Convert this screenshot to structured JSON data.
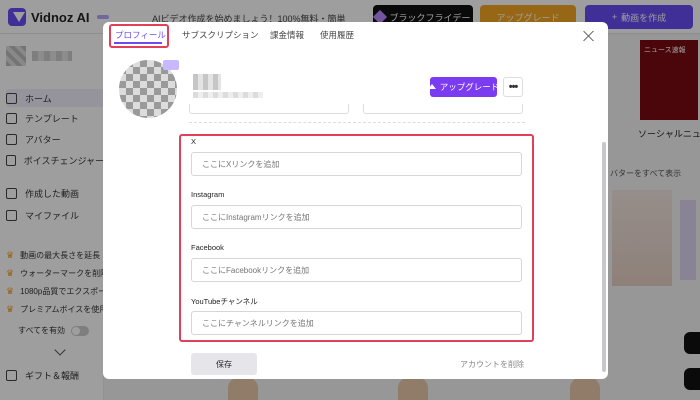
{
  "app": {
    "logo_text": "Vidnoz AI",
    "logo_badge": "",
    "promo_text": "AIビデオ作成を始めましょう！100%無料・簡単",
    "black_friday_label": "ブラックフライデー",
    "upgrade_label": "アップグレード",
    "create_video_label": "動画を作成"
  },
  "sidebar": {
    "items": [
      {
        "label": "ホーム"
      },
      {
        "label": "テンプレート"
      },
      {
        "label": "アバター"
      },
      {
        "label": "ボイスチェンジャー"
      },
      {
        "label": "作成した動画"
      },
      {
        "label": "マイファイル"
      }
    ],
    "premium": [
      {
        "label": "動画の最大長さを延長"
      },
      {
        "label": "ウォーターマークを削除"
      },
      {
        "label": "1080p品質でエクスポート"
      },
      {
        "label": "プレミアムボイスを使用"
      }
    ],
    "enable_all_label": "すべてを有効",
    "gift_label": "ギフト＆報酬"
  },
  "right_panel": {
    "card_text": "ニュース速報",
    "label": "ソーシャルニュ",
    "link": "バターをすべて表示"
  },
  "modal": {
    "tabs": [
      {
        "label": "プロフィール"
      },
      {
        "label": "サブスクリプション"
      },
      {
        "label": "課金情報"
      },
      {
        "label": "使用履歴"
      }
    ],
    "upgrade_label": "アップグレード",
    "more_label": "•••",
    "fields": [
      {
        "label": "X",
        "placeholder": "ここにXリンクを追加"
      },
      {
        "label": "Instagram",
        "placeholder": "ここにInstagramリンクを追加"
      },
      {
        "label": "Facebook",
        "placeholder": "ここにFacebookリンクを追加"
      },
      {
        "label": "YouTubeチャンネル",
        "placeholder": "ここにチャンネルリンクを追加"
      }
    ],
    "save_label": "保存",
    "delete_account_label": "アカウントを削除"
  },
  "colors": {
    "accent": "#6a4cf5",
    "highlight": "#e0405a",
    "upgrade_orange": "#f5a623"
  }
}
